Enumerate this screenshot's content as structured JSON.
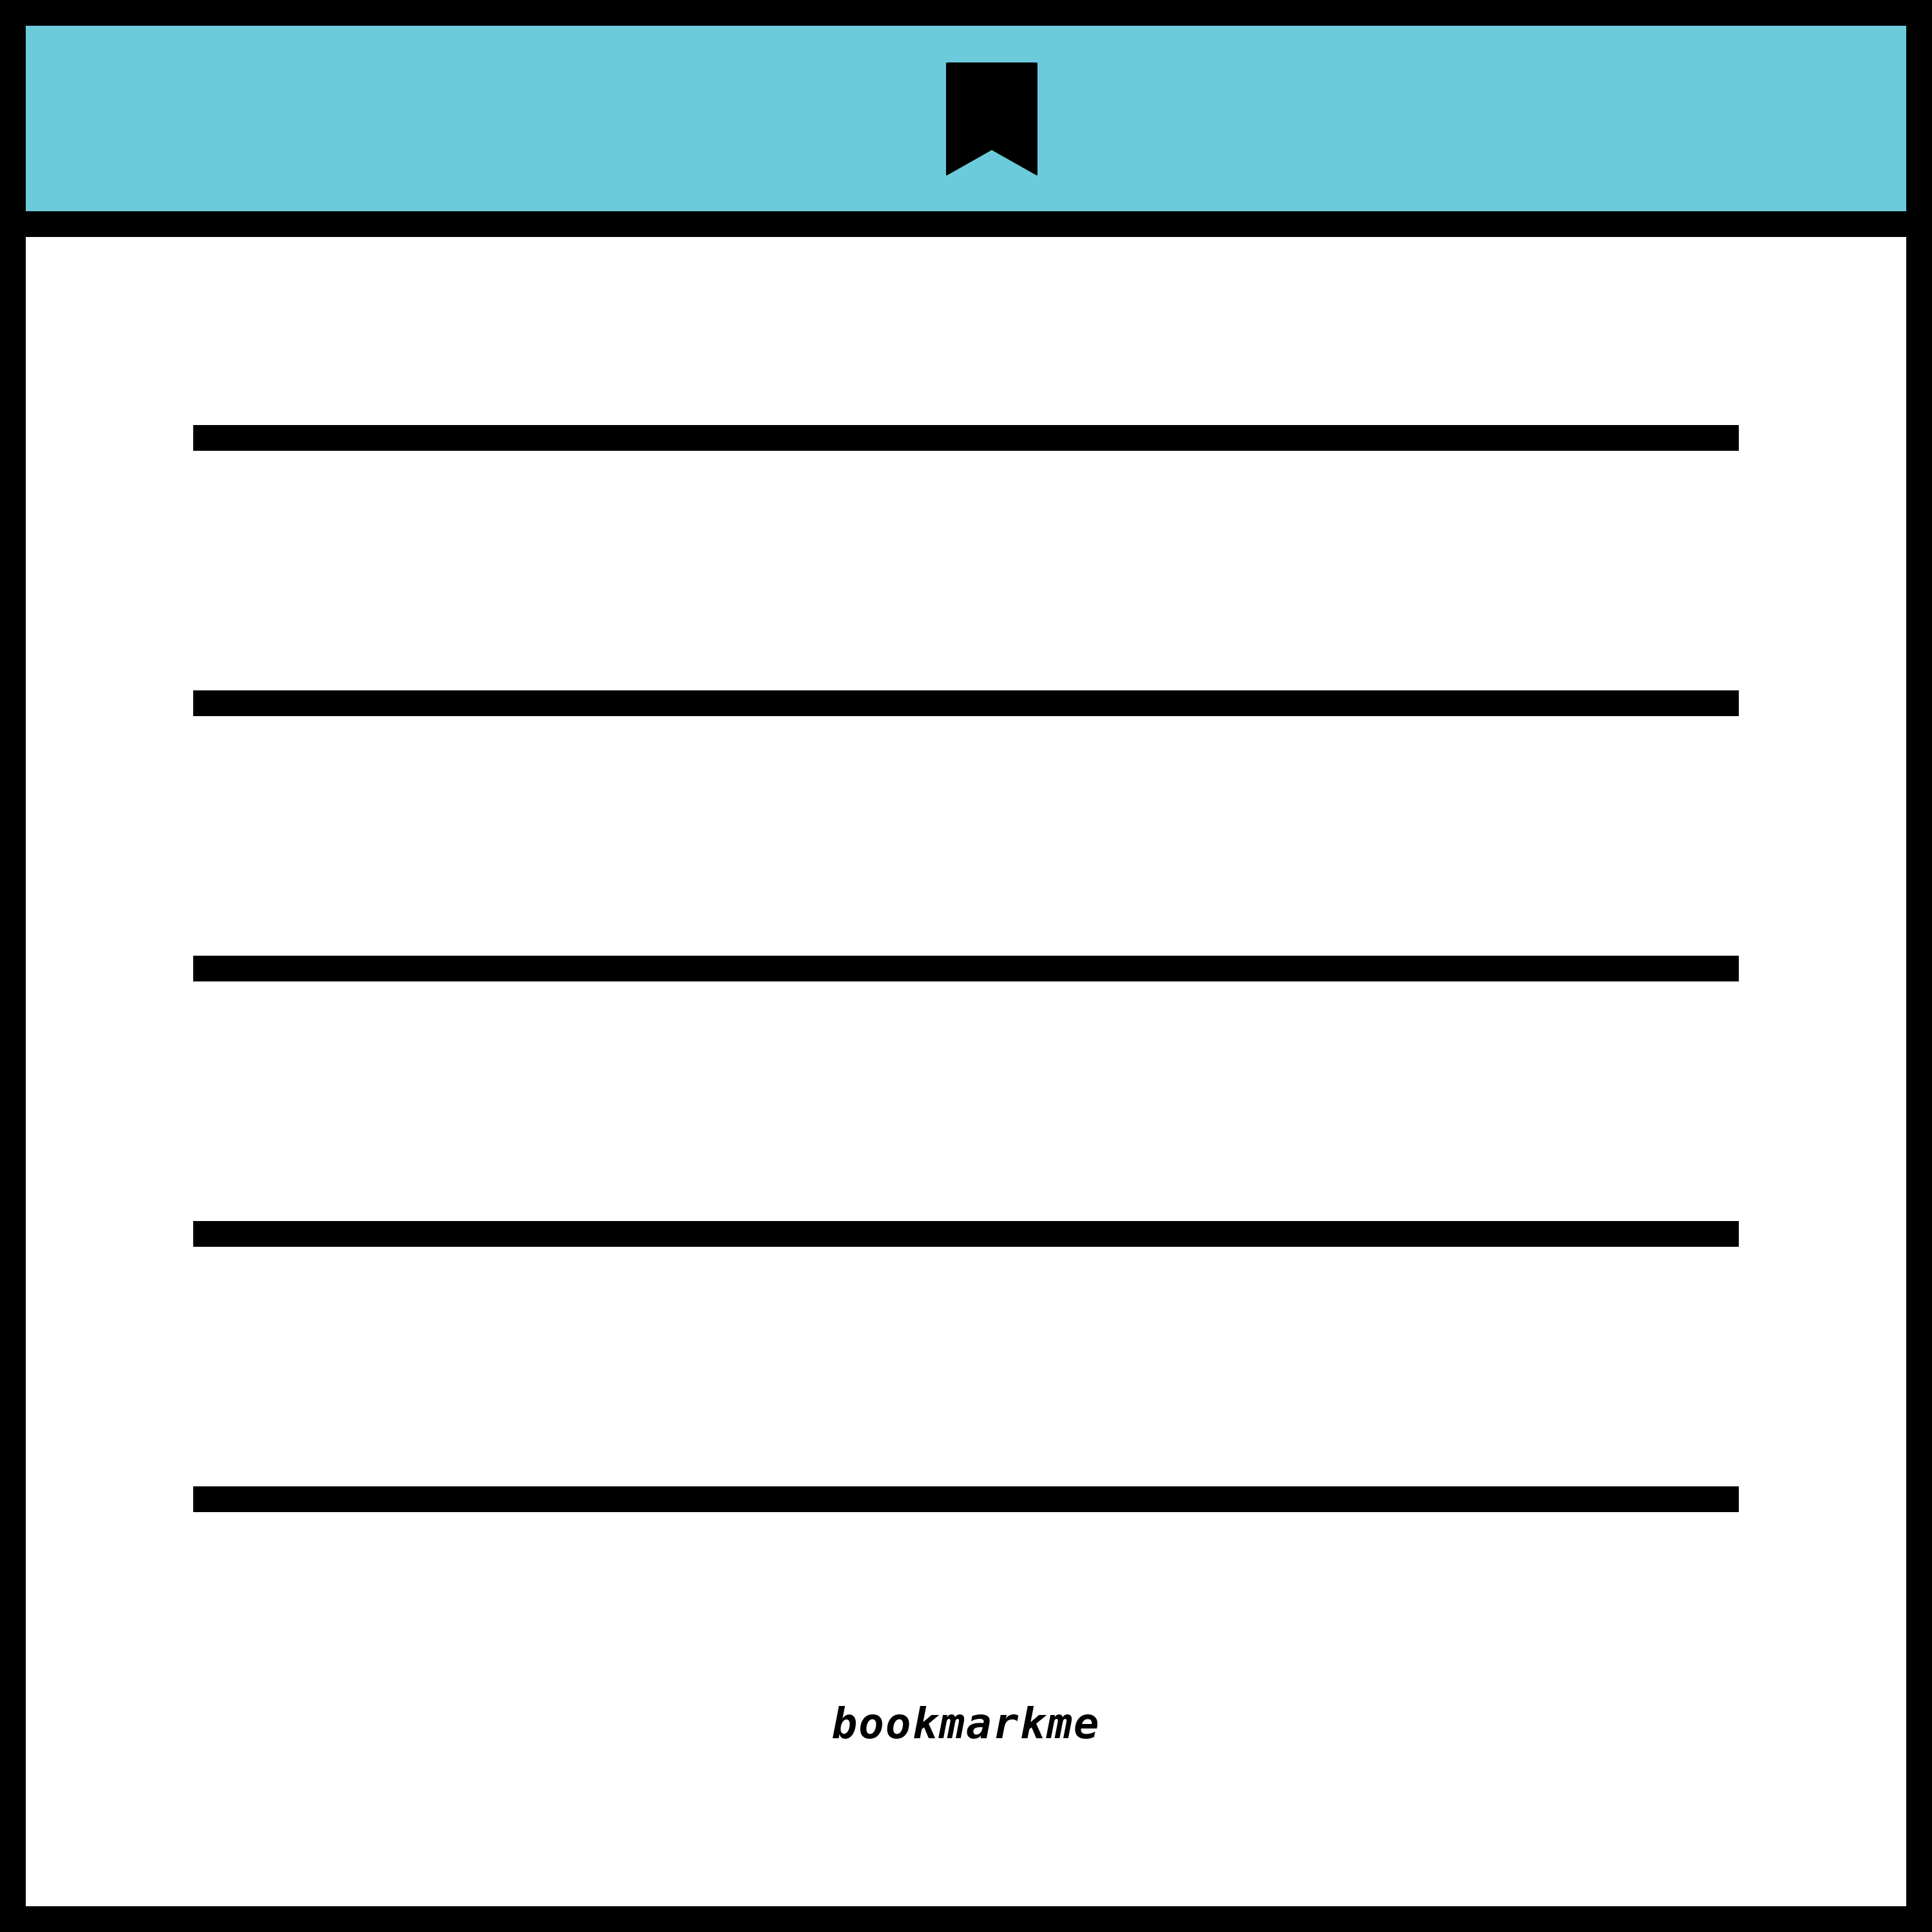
{
  "header": {
    "background_color": "#6ccbdb",
    "icon": "bookmark-icon"
  },
  "card": {
    "background_color": "#ffffff",
    "frame_color": "#000000",
    "line_count": 5
  },
  "footer": {
    "brand_text": "bookmarkme"
  }
}
